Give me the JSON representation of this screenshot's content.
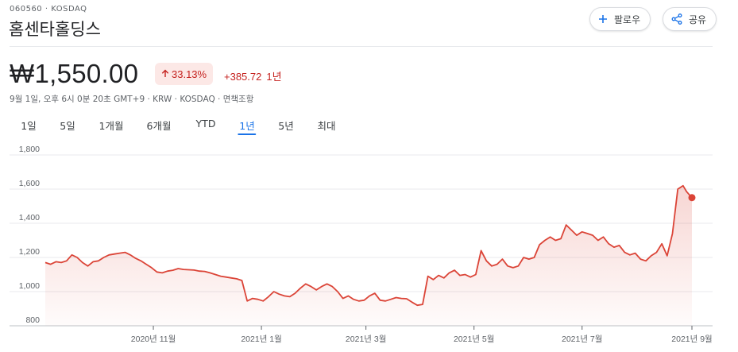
{
  "header": {
    "ticker": "060560 · KOSDAQ",
    "company_name": "홈센타홀딩스",
    "follow_label": "팔로우",
    "share_label": "공유"
  },
  "quote": {
    "price": "₩1,550.00",
    "change_percent": "33.13%",
    "change_abs": "+385.72",
    "period_label": "1년",
    "meta": "9월 1일, 오후 6시 0분 20초 GMT+9 · KRW · KOSDAQ · 면책조항",
    "status_color": "#c5221f"
  },
  "range_tabs": [
    {
      "label": "1일"
    },
    {
      "label": "5일"
    },
    {
      "label": "1개월"
    },
    {
      "label": "6개월"
    },
    {
      "label": "YTD"
    },
    {
      "label": "1년",
      "active": true
    },
    {
      "label": "5년"
    },
    {
      "label": "최대"
    }
  ],
  "chart_data": {
    "type": "line",
    "ylim": [
      800,
      1800
    ],
    "yticks": [
      "1,800",
      "1,600",
      "1,400",
      "1,200",
      "1,000",
      "800"
    ],
    "xtick_labels": [
      "2020년 11월",
      "2021년 1월",
      "2021년 3월",
      "2021년 5월",
      "2021년 7월",
      "2021년 9월"
    ],
    "xtick_dates": [
      "2020-11-01",
      "2021-01-01",
      "2021-03-01",
      "2021-05-01",
      "2021-07-01",
      "2021-09-01"
    ],
    "x_range": [
      "2020-09-01",
      "2021-09-01"
    ],
    "line_color": "#db4437",
    "series": [
      {
        "points": [
          [
            "2020-09-01",
            1170
          ],
          [
            "2020-09-04",
            1160
          ],
          [
            "2020-09-07",
            1175
          ],
          [
            "2020-09-10",
            1170
          ],
          [
            "2020-09-13",
            1180
          ],
          [
            "2020-09-16",
            1215
          ],
          [
            "2020-09-19",
            1200
          ],
          [
            "2020-09-22",
            1170
          ],
          [
            "2020-09-25",
            1150
          ],
          [
            "2020-09-28",
            1175
          ],
          [
            "2020-10-01",
            1180
          ],
          [
            "2020-10-04",
            1200
          ],
          [
            "2020-10-07",
            1215
          ],
          [
            "2020-10-10",
            1220
          ],
          [
            "2020-10-13",
            1225
          ],
          [
            "2020-10-16",
            1230
          ],
          [
            "2020-10-19",
            1215
          ],
          [
            "2020-10-22",
            1195
          ],
          [
            "2020-10-25",
            1180
          ],
          [
            "2020-10-28",
            1160
          ],
          [
            "2020-10-31",
            1140
          ],
          [
            "2020-11-03",
            1115
          ],
          [
            "2020-11-06",
            1110
          ],
          [
            "2020-11-09",
            1120
          ],
          [
            "2020-11-12",
            1125
          ],
          [
            "2020-11-15",
            1135
          ],
          [
            "2020-11-18",
            1130
          ],
          [
            "2020-11-21",
            1128
          ],
          [
            "2020-11-24",
            1126
          ],
          [
            "2020-11-27",
            1120
          ],
          [
            "2020-11-30",
            1118
          ],
          [
            "2020-12-03",
            1110
          ],
          [
            "2020-12-06",
            1100
          ],
          [
            "2020-12-09",
            1090
          ],
          [
            "2020-12-12",
            1085
          ],
          [
            "2020-12-15",
            1080
          ],
          [
            "2020-12-18",
            1075
          ],
          [
            "2020-12-21",
            1065
          ],
          [
            "2020-12-24",
            945
          ],
          [
            "2020-12-27",
            960
          ],
          [
            "2020-12-30",
            955
          ],
          [
            "2021-01-02",
            945
          ],
          [
            "2021-01-05",
            970
          ],
          [
            "2021-01-08",
            1000
          ],
          [
            "2021-01-11",
            985
          ],
          [
            "2021-01-14",
            975
          ],
          [
            "2021-01-17",
            970
          ],
          [
            "2021-01-20",
            990
          ],
          [
            "2021-01-23",
            1020
          ],
          [
            "2021-01-26",
            1045
          ],
          [
            "2021-01-29",
            1030
          ],
          [
            "2021-02-01",
            1010
          ],
          [
            "2021-02-04",
            1030
          ],
          [
            "2021-02-07",
            1045
          ],
          [
            "2021-02-10",
            1030
          ],
          [
            "2021-02-13",
            1000
          ],
          [
            "2021-02-16",
            960
          ],
          [
            "2021-02-19",
            975
          ],
          [
            "2021-02-22",
            955
          ],
          [
            "2021-02-25",
            945
          ],
          [
            "2021-02-28",
            950
          ],
          [
            "2021-03-03",
            975
          ],
          [
            "2021-03-06",
            990
          ],
          [
            "2021-03-09",
            950
          ],
          [
            "2021-03-12",
            945
          ],
          [
            "2021-03-15",
            955
          ],
          [
            "2021-03-18",
            965
          ],
          [
            "2021-03-21",
            960
          ],
          [
            "2021-03-24",
            958
          ],
          [
            "2021-03-27",
            938
          ],
          [
            "2021-03-30",
            920
          ],
          [
            "2021-04-02",
            925
          ],
          [
            "2021-04-05",
            1090
          ],
          [
            "2021-04-08",
            1070
          ],
          [
            "2021-04-11",
            1095
          ],
          [
            "2021-04-14",
            1080
          ],
          [
            "2021-04-17",
            1110
          ],
          [
            "2021-04-20",
            1125
          ],
          [
            "2021-04-23",
            1095
          ],
          [
            "2021-04-26",
            1100
          ],
          [
            "2021-04-29",
            1085
          ],
          [
            "2021-05-02",
            1100
          ],
          [
            "2021-05-05",
            1240
          ],
          [
            "2021-05-08",
            1180
          ],
          [
            "2021-05-11",
            1150
          ],
          [
            "2021-05-14",
            1160
          ],
          [
            "2021-05-17",
            1190
          ],
          [
            "2021-05-20",
            1150
          ],
          [
            "2021-05-23",
            1140
          ],
          [
            "2021-05-26",
            1150
          ],
          [
            "2021-05-29",
            1200
          ],
          [
            "2021-06-01",
            1190
          ],
          [
            "2021-06-04",
            1200
          ],
          [
            "2021-06-07",
            1275
          ],
          [
            "2021-06-10",
            1300
          ],
          [
            "2021-06-13",
            1320
          ],
          [
            "2021-06-16",
            1300
          ],
          [
            "2021-06-19",
            1310
          ],
          [
            "2021-06-22",
            1390
          ],
          [
            "2021-06-25",
            1360
          ],
          [
            "2021-06-28",
            1330
          ],
          [
            "2021-07-01",
            1350
          ],
          [
            "2021-07-04",
            1340
          ],
          [
            "2021-07-07",
            1330
          ],
          [
            "2021-07-10",
            1300
          ],
          [
            "2021-07-13",
            1320
          ],
          [
            "2021-07-16",
            1280
          ],
          [
            "2021-07-19",
            1260
          ],
          [
            "2021-07-22",
            1270
          ],
          [
            "2021-07-25",
            1230
          ],
          [
            "2021-07-28",
            1215
          ],
          [
            "2021-07-31",
            1225
          ],
          [
            "2021-08-03",
            1190
          ],
          [
            "2021-08-06",
            1180
          ],
          [
            "2021-08-09",
            1210
          ],
          [
            "2021-08-12",
            1230
          ],
          [
            "2021-08-15",
            1280
          ],
          [
            "2021-08-18",
            1210
          ],
          [
            "2021-08-21",
            1340
          ],
          [
            "2021-08-24",
            1600
          ],
          [
            "2021-08-27",
            1620
          ],
          [
            "2021-08-29",
            1585
          ],
          [
            "2021-09-01",
            1550
          ]
        ]
      }
    ]
  }
}
